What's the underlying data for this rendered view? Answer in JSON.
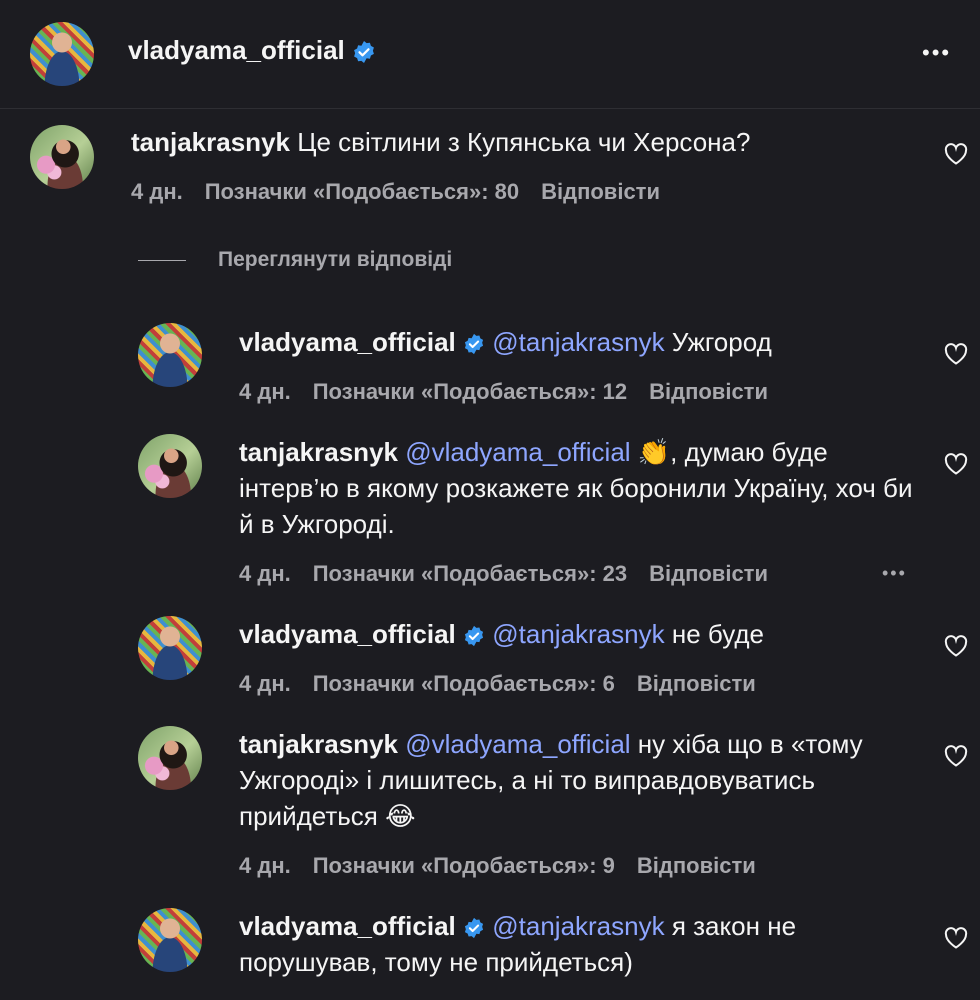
{
  "header": {
    "username": "vladyama_official",
    "more_label": "•••"
  },
  "view_replies_label": "Переглянути відповіді",
  "comment": {
    "username": "tanjakrasnyk",
    "text": "Це світлини з Купянська чи Херсона?",
    "time": "4 дн.",
    "likes": "Позначки «Подобається»: 80",
    "reply": "Відповісти"
  },
  "replies": [
    {
      "username": "vladyama_official",
      "mention": "@tanjakrasnyk",
      "text": " Ужгород",
      "time": "4 дн.",
      "likes": "Позначки «Подобається»: 12",
      "reply": "Відповісти"
    },
    {
      "username": "tanjakrasnyk",
      "mention": "@vladyama_official",
      "text": " 👏, думаю буде інтерв’ю в якому розкажете як боронили Україну, хоч би й в Ужгороді.",
      "time": "4 дн.",
      "likes": "Позначки «Подобається»: 23",
      "reply": "Відповісти",
      "more": "•••"
    },
    {
      "username": "vladyama_official",
      "mention": "@tanjakrasnyk",
      "text": " не буде",
      "time": "4 дн.",
      "likes": "Позначки «Подобається»: 6",
      "reply": "Відповісти"
    },
    {
      "username": "tanjakrasnyk",
      "mention": "@vladyama_official",
      "text": " ну хіба що в «тому Ужгороді» і лишитесь, а ні то виправдовуватись прийдеться 😂",
      "time": "4 дн.",
      "likes": "Позначки «Подобається»: 9",
      "reply": "Відповісти"
    },
    {
      "username": "vladyama_official",
      "mention": "@tanjakrasnyk",
      "text": " я закон не порушував, тому не прийдеться)"
    }
  ]
}
